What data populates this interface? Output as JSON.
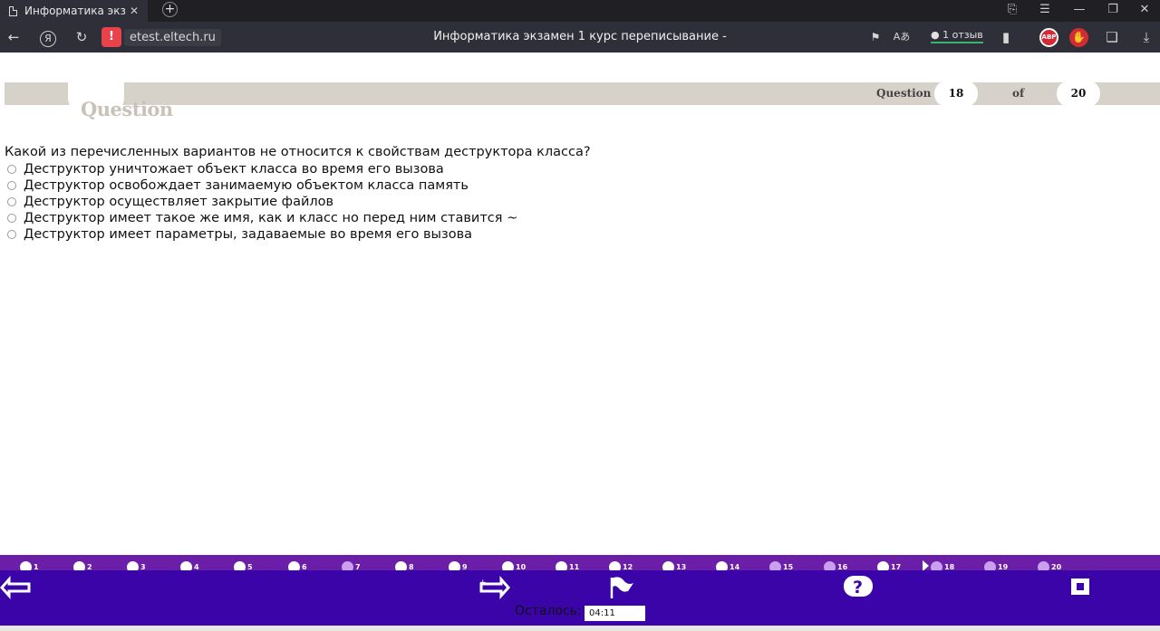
{
  "browser": {
    "tab_title": "Информатика экзамен",
    "tab_close": "✕",
    "new_tab": "+",
    "url_host": "etest.eltech.ru",
    "page_title": "Информатика экзамен 1 курс переписывание -",
    "reviews": "1 отзыв",
    "abp": "ABP"
  },
  "header": {
    "logo_text": "Question",
    "question_label": "Question",
    "current": "18",
    "of_label": "of",
    "total": "20"
  },
  "question": {
    "text": "Какой из перечисленных вариантов не относится к свойствам деструктора класса?",
    "options": [
      "Деструктор уничтожает объект класса во время его вызова",
      "Деструктор освобождает занимаемую объектом класса память",
      "Деструктор осуществляет закрытие файлов",
      "Деструктор имеет такое же имя, как и класс но перед ним ставится ~",
      "Деструктор имеет параметры, задаваемые во время его вызова"
    ]
  },
  "nav": {
    "numbers": [
      "1",
      "2",
      "3",
      "4",
      "5",
      "6",
      "7",
      "8",
      "9",
      "10",
      "11",
      "12",
      "13",
      "14",
      "15",
      "16",
      "17",
      "18",
      "19",
      "20"
    ],
    "answered": [
      7,
      15,
      16,
      18,
      19,
      20
    ],
    "current": 18
  },
  "footer": {
    "remaining_label": "Осталось:",
    "remaining_time": "04:11"
  },
  "colors": {
    "accent": "#3a04a8",
    "nav_strip": "#6b1fa8",
    "band": "#d6d1c9"
  }
}
